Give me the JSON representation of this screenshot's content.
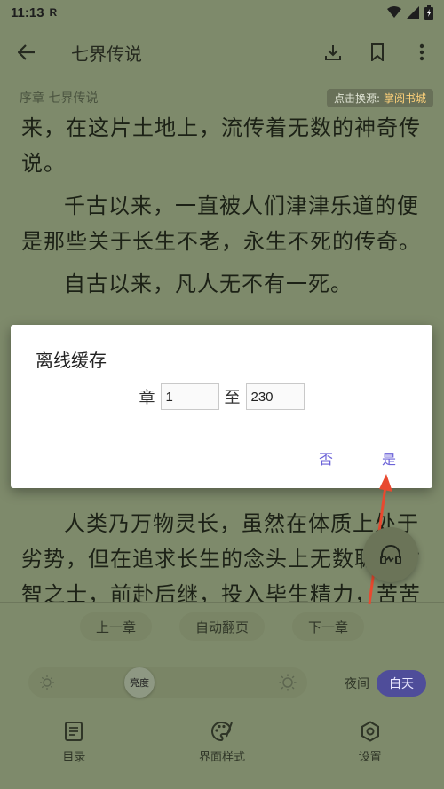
{
  "status_bar": {
    "time": "11:13",
    "carrier_mark": "R"
  },
  "app_bar": {
    "title": "七界传说"
  },
  "chapter": {
    "label": "序章 七界传说",
    "source_prefix": "点击换源:",
    "source_name": "掌阅书城"
  },
  "content": {
    "paragraphs": [
      "来，在这片土地上，流传着无数的神奇传说。",
      "千古以来，一直被人们津津乐道的便是那些关于长生不老，永生不死的传奇。",
      "自古以来，凡人无不有一死。",
      "人类乃万物灵长，虽然在体质上处于劣势，但在追求长生的念头上无数聪明才智之士，前赴后继，投入毕生精力，苦苦钻研"
    ]
  },
  "dialog": {
    "title": "离线缓存",
    "chapter_label": "章",
    "from_value": "1",
    "to_label": "至",
    "to_value": "230",
    "no_label": "否",
    "yes_label": "是"
  },
  "nav": {
    "prev": "上一章",
    "auto": "自动翻页",
    "next": "下一章"
  },
  "brightness": {
    "label": "亮度"
  },
  "theme": {
    "night": "夜间",
    "day": "白天"
  },
  "tabs": [
    {
      "label": "目录",
      "icon": "catalog-icon"
    },
    {
      "label": "界面样式",
      "icon": "palette-icon"
    },
    {
      "label": "设置",
      "icon": "settings-icon"
    }
  ],
  "colors": {
    "page_bg": "#7e8a6b",
    "accent": "#6c63d8",
    "day_pill": "#4f4d9a",
    "arrow": "#e8492f"
  }
}
